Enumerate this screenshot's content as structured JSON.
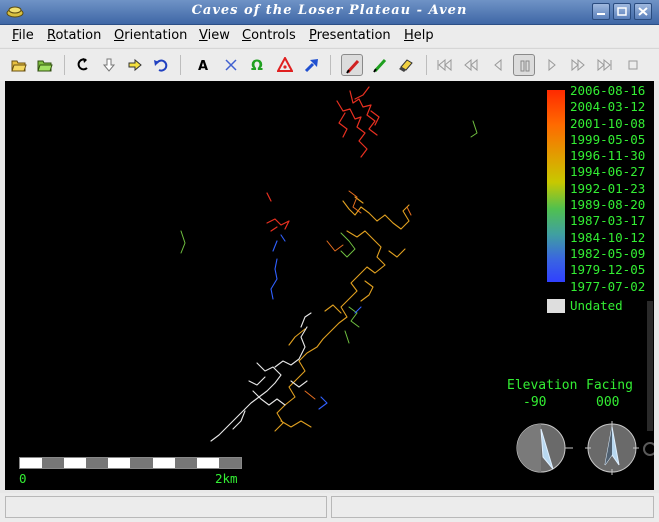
{
  "window": {
    "title": "Caves of the Loser Plateau - Aven"
  },
  "menubar": {
    "items": [
      {
        "key": "F",
        "rest": "ile"
      },
      {
        "key": "R",
        "rest": "otation"
      },
      {
        "key": "O",
        "rest": "rientation"
      },
      {
        "key": "V",
        "rest": "iew"
      },
      {
        "key": "C",
        "rest": "ontrols"
      },
      {
        "key": "P",
        "rest": "resentation"
      },
      {
        "key": "H",
        "rest": "elp"
      }
    ]
  },
  "toolbar": {
    "icons": [
      "open-survey-icon",
      "open-presentation-icon",
      "rotate-icon",
      "move-down-icon",
      "move-right-icon",
      "undo-icon",
      "names-icon",
      "crosses-icon",
      "entrances-icon",
      "fixed-points-icon",
      "exported-points-icon",
      "survey-legs-icon",
      "surface-legs-icon",
      "tubes-icon",
      "skip-to-start-icon",
      "rewind-icon",
      "step-back-icon",
      "pause-icon",
      "play-icon",
      "fast-forward-icon",
      "skip-to-end-icon",
      "stop-icon"
    ],
    "active": "survey-legs-icon"
  },
  "viewer": {
    "legend_dates": [
      "2006-08-16",
      "2004-03-12",
      "2001-10-08",
      "1999-05-05",
      "1996-11-30",
      "1994-06-27",
      "1992-01-23",
      "1989-08-20",
      "1987-03-17",
      "1984-10-12",
      "1982-05-09",
      "1979-12-05",
      "1977-07-02"
    ],
    "undated_label": "Undated",
    "elevation": {
      "label": "Elevation",
      "value": "-90"
    },
    "facing": {
      "label": "Facing",
      "value": "000"
    },
    "scale": {
      "start": "0",
      "end": "2km"
    },
    "colors": {
      "background": "#000000",
      "label_text": "#33ee33"
    }
  },
  "statusbar": {
    "left": "",
    "right": ""
  }
}
